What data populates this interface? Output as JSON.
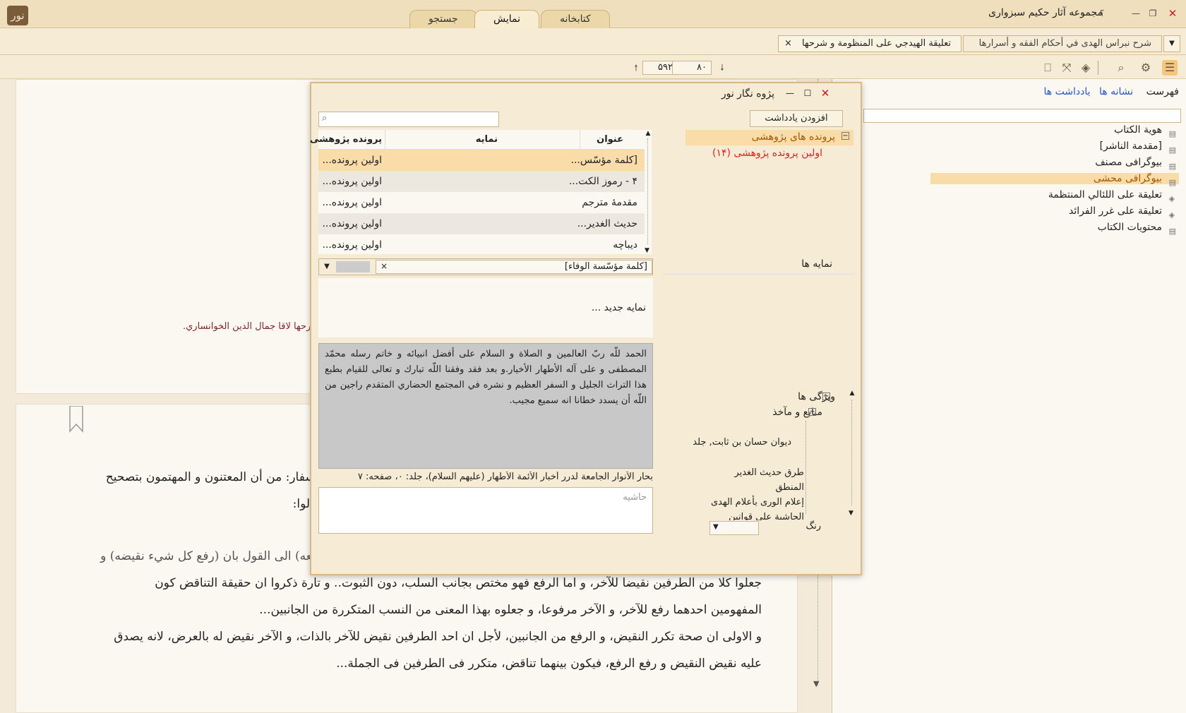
{
  "app": {
    "title": "مجموعه آثار حکیم سبزواری",
    "logo_text": "نور"
  },
  "window_controls": {
    "close": "✕",
    "maximize": "❐",
    "minimize": "—",
    "help": "؟"
  },
  "main_tabs": [
    "کتابخانه",
    "نمایش",
    "جستجو"
  ],
  "doc_tabs": {
    "tab1": "شرح نبراس الهدى في أحكام الفقه و أسرارها",
    "tab2": "تعليقة الهيدجي على المنظومة و شرحها",
    "close_icon": "×"
  },
  "toolbar": {
    "page_current": "۸۰",
    "page_total": "۵۹۲"
  },
  "right_panel": {
    "tabs": {
      "index": "فهرست",
      "bookmarks": "نشانه ها",
      "notes": "یادداشت ها"
    },
    "search_placeholder": "",
    "toc": [
      "هوية الكتاب",
      "[مقدمة الناشر]",
      "بیوگرافی مصنف",
      "بیوگرافی محشی",
      "تعليقة على اللئالي المنتظمة",
      "تعليقة على غرر الفرائد",
      "محتويات الكتاب"
    ],
    "toc_selected": 3
  },
  "content": {
    "top_page_line": "ي، و شرحها لاقا جمال الدين الخوانساري.",
    "para1_line1": "الاسفار: من أن المعتنون و المهتمون بتصحيح",
    "para1_line2": "فقالوا:",
    "para2_line0": "و قد فرع عليهما، بأن لا نقيض كل شيء رفعه... فمارة عبروا الموت بأن (نقيض كل شيء رفعه) الى القول بان (رفع كل شيء نقيضه) و",
    "para2_line1": "جعلوا كلا من الطرفين نقيضا للآخر، و اما الرفع فهو مختص بجانب السلب، دون الثبوت.. و تارة ذكروا ان حقيقة التناقض كون",
    "para2_line2": "المفهومين احدهما رفع للآخر، و الآخر مرفوعا، و جعلوه بهذا المعنى من النسب المتكررة من الجانبين...",
    "para3_line1": "و الاولى ان صحة تكرر النقيض، و الرفع من الجانبين، لأجل ان احد الطرفين نقيض للآخر بالذات، و الآخر نقيض له بالعرض، لانه يصدق",
    "para3_line2": "عليه نقيض النقيض و رفع الرفع، فيكون بينهما تناقض، متكرر فى الطرفين فى الجملة..."
  },
  "dialog": {
    "title": "پژوه نگار نور",
    "add_note_button": "افزودن یادداشت",
    "search_placeholder": "",
    "research_files_root": "پرونده های پژوهشی",
    "research_file_1": "اولین پرونده پژوهشی (۱۴)",
    "columns": {
      "title": "عنوان",
      "nemayeh": "نمایه",
      "file": "پرونده پژوهشی"
    },
    "rows": [
      {
        "title": "[كلمة مؤسّس...",
        "nemayeh": "",
        "file": "اولین پرونده..."
      },
      {
        "title": "۴ - رموز الكت...",
        "nemayeh": "",
        "file": "اولین پرونده..."
      },
      {
        "title": "مقدمهٔ مترجم",
        "nemayeh": "",
        "file": "اولین پرونده..."
      },
      {
        "title": "حديث الغدير...",
        "nemayeh": "",
        "file": "اولین پرونده..."
      },
      {
        "title": "ديباچه",
        "nemayeh": "",
        "file": "اولین پرونده..."
      }
    ],
    "selected_title": "[كلمة مؤسّسة الوفاء]",
    "nemayeh_label": "نمایه ها",
    "new_nemayeh": "نمایه جدید ...",
    "note_text": "الحمد للّه ربّ العالمين و الصلاة و السلام على أفضل انبيائه و خاتم رسله محمّد المصطفى و على آله الأطهار الأخيار.و بعد فقد وفقنا اللّه تبارك و تعالى للقيام بطبع هذا التراث الجليل و السفر العظيم و نشره في المجتمع الحضاري المتقدم راجين من اللّه أن يسدد خطانا انه سميع مجيب.",
    "source_ref": "بحار الأنوار الجامعة لدرر أخبار الأئمة الأطهار (عليهم السلام)، جلد: ۰، صفحه: ۷",
    "footnote_placeholder": "حاشیه",
    "properties_label": "ویژگی ها",
    "sources_label": "منابع و مآخذ",
    "sources": [
      "ديوان حسان بن ثابت, جلد",
      "طرق حديث الغدير",
      "المنطق",
      "إعلام الورى بأعلام الهدى",
      "الحاشية على قوانين"
    ],
    "color_label": "رنگ"
  },
  "colors": {
    "accent": "#f5c77e",
    "selected_toc": "#f9dca8",
    "link": "#2a55c8",
    "red": "#e02020"
  }
}
